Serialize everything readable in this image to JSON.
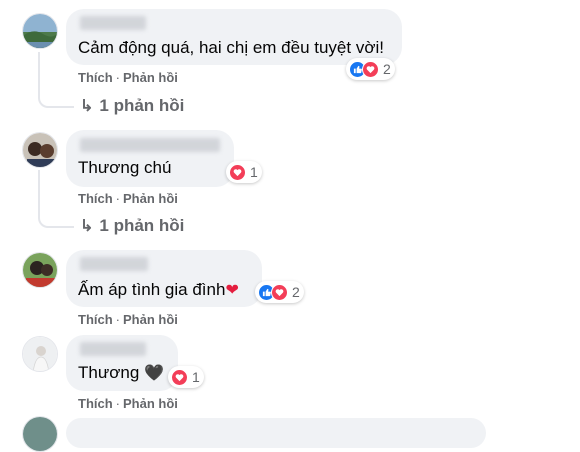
{
  "comments": [
    {
      "text": "Cảm động quá, hai chị em đều tuyệt vời!",
      "like_label": "Thích",
      "separator": "·",
      "reply_label": "Phản hồi",
      "reaction_count": "2",
      "replies_label": "1 phản hồi",
      "reactions": [
        "like-icon",
        "love-icon"
      ]
    },
    {
      "text": "Thương chú",
      "like_label": "Thích",
      "separator": "·",
      "reply_label": "Phản hồi",
      "reaction_count": "1",
      "replies_label": "1 phản hồi",
      "reactions": [
        "love-icon"
      ]
    },
    {
      "text": "Ấm áp tình gia đình",
      "emoji": "❤",
      "like_label": "Thích",
      "separator": "·",
      "reply_label": "Phản hồi",
      "reaction_count": "2",
      "reactions": [
        "like-icon",
        "love-icon"
      ]
    },
    {
      "text": "Thương",
      "emoji": "🖤",
      "like_label": "Thích",
      "separator": "·",
      "reply_label": "Phản hồi",
      "reaction_count": "1",
      "reactions": [
        "love-icon"
      ]
    }
  ],
  "colors": {
    "like": "#1877f2",
    "love": "#f33e58",
    "bubble": "#f0f2f5",
    "meta": "#65676b"
  }
}
